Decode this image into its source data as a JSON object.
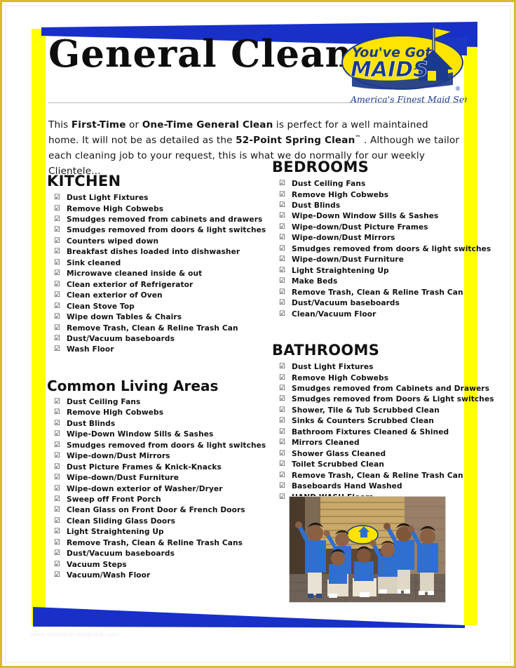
{
  "document": {
    "title": "General Clean",
    "intro": {
      "prefix": "This ",
      "bold1": "First-Time",
      "mid1": " or ",
      "bold2": "One-Time General Clean",
      "mid2": " is perfect for a well maintained home.  It will not be as detailed as the ",
      "bold3": "52-Point Spring Clean",
      "tm": "™",
      "suffix": " .  Although we tailor each cleaning job to your request, this is what we do normally for our weekly Clientele..."
    },
    "watermark": "www.example-template.com"
  },
  "logo": {
    "line1": "You've Got",
    "line2": "MAIDS",
    "tagline": "America's Finest Maid Service",
    "registered": "®",
    "colors": {
      "yellow": "#ffe400",
      "blue": "#1a3a8f",
      "band_blue": "#1b35c4"
    }
  },
  "theme": {
    "yellow_bar": "#ffff00",
    "blue_wedge": "#1830c8",
    "gold_border": "#d8bc2e",
    "text": "#121212"
  },
  "checkbox_glyph": "☑",
  "sections": [
    {
      "id": "kitchen",
      "heading": "KITCHEN",
      "style": "caps",
      "column": "left",
      "items": [
        "Dust Light Fixtures",
        "Remove High Cobwebs",
        "Smudges removed from cabinets and drawers",
        "Smudges removed from doors & light switches",
        "Counters wiped down",
        "Breakfast dishes loaded into dishwasher",
        "Sink cleaned",
        "Microwave cleaned inside & out",
        "Clean exterior of Refrigerator",
        "Clean exterior of Oven",
        "Clean Stove Top",
        "Wipe down Tables & Chairs",
        "Remove Trash, Clean & Reline Trash Can",
        "Dust/Vacuum baseboards",
        "Wash Floor"
      ]
    },
    {
      "id": "common-living-areas",
      "heading": "Common Living Areas",
      "style": "mixed",
      "column": "left",
      "items": [
        "Dust Ceiling Fans",
        "Remove High Cobwebs",
        "Dust Blinds",
        "Wipe-Down Window Sills & Sashes",
        "Smudges removed from doors & light switches",
        "Wipe-down/Dust Mirrors",
        "Dust Picture Frames & Knick-Knacks",
        "Wipe-down/Dust Furniture",
        "Wipe-down exterior of Washer/Dryer",
        "Sweep off Front Porch",
        "Clean Glass on Front Door & French Doors",
        "Clean Sliding Glass Doors",
        "Light Straightening Up",
        "Remove Trash, Clean & Reline Trash Cans",
        "Dust/Vacuum baseboards",
        "Vacuum Steps",
        "Vacuum/Wash Floor"
      ]
    },
    {
      "id": "bedrooms",
      "heading": "BEDROOMS",
      "style": "caps",
      "column": "right",
      "items": [
        "Dust Ceiling Fans",
        "Remove High Cobwebs",
        "Dust Blinds",
        "Wipe-Down Window Sills & Sashes",
        "Wipe-down/Dust Picture Frames",
        "Wipe-down/Dust Mirrors",
        "Smudges removed from doors & light switches",
        "Wipe-down/Dust Furniture",
        "Light Straightening Up",
        "Make Beds",
        "Remove Trash, Clean & Reline Trash Can",
        "Dust/Vacuum baseboards",
        "Clean/Vacuum Floor"
      ]
    },
    {
      "id": "bathrooms",
      "heading": "BATHROOMS",
      "style": "caps",
      "column": "right",
      "items": [
        "Dust Light Fixtures",
        "Remove High Cobwebs",
        "Smudges removed from Cabinets and Drawers",
        "Smudges removed from Doors & Light switches",
        "Shower, Tile & Tub Scrubbed Clean",
        "Sinks & Counters Scrubbed Clean",
        "Bathroom Fixtures Cleaned & Shined",
        "Mirrors Cleaned",
        "Shower Glass Cleaned",
        "Toilet Scrubbed Clean",
        "Remove Trash, Clean & Reline Trash Can",
        "Baseboards Hand Washed",
        "HAND WASH Floors"
      ]
    }
  ],
  "photo": {
    "alt": "team-photo-cleaning-staff-waving"
  }
}
